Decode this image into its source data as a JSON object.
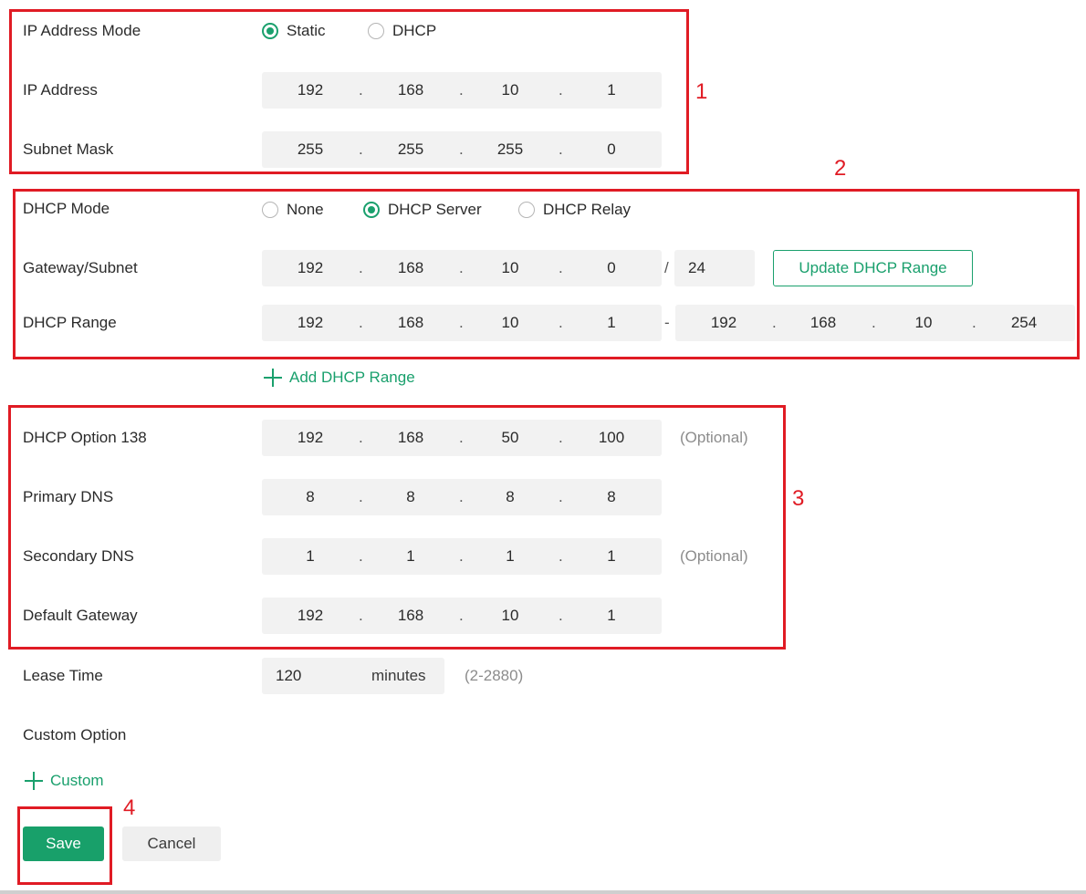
{
  "ip_address_mode": {
    "label": "IP Address Mode",
    "options": [
      {
        "label": "Static",
        "checked": true
      },
      {
        "label": "DHCP",
        "checked": false
      }
    ]
  },
  "ip_address": {
    "label": "IP Address",
    "octets": [
      "192",
      "168",
      "10",
      "1"
    ]
  },
  "subnet_mask": {
    "label": "Subnet Mask",
    "octets": [
      "255",
      "255",
      "255",
      "0"
    ]
  },
  "dhcp_mode": {
    "label": "DHCP Mode",
    "options": [
      {
        "label": "None",
        "checked": false
      },
      {
        "label": "DHCP Server",
        "checked": true
      },
      {
        "label": "DHCP Relay",
        "checked": false
      }
    ]
  },
  "gateway_subnet": {
    "label": "Gateway/Subnet",
    "octets": [
      "192",
      "168",
      "10",
      "0"
    ],
    "slash": "/",
    "prefix": "24",
    "update_button": "Update DHCP Range"
  },
  "dhcp_range": {
    "label": "DHCP Range",
    "start": [
      "192",
      "168",
      "10",
      "1"
    ],
    "separator": "-",
    "end": [
      "192",
      "168",
      "10",
      "254"
    ]
  },
  "add_dhcp_range": "Add DHCP Range",
  "dhcp_option_138": {
    "label": "DHCP Option 138",
    "octets": [
      "192",
      "168",
      "50",
      "100"
    ],
    "hint": "(Optional)"
  },
  "primary_dns": {
    "label": "Primary DNS",
    "octets": [
      "8",
      "8",
      "8",
      "8"
    ]
  },
  "secondary_dns": {
    "label": "Secondary DNS",
    "octets": [
      "1",
      "1",
      "1",
      "1"
    ],
    "hint": "(Optional)"
  },
  "default_gateway": {
    "label": "Default Gateway",
    "octets": [
      "192",
      "168",
      "10",
      "1"
    ]
  },
  "lease_time": {
    "label": "Lease Time",
    "value": "120",
    "unit": "minutes",
    "hint": "(2-2880)"
  },
  "custom_option": {
    "label": "Custom Option",
    "add_label": "Custom"
  },
  "buttons": {
    "save": "Save",
    "cancel": "Cancel"
  },
  "annotations": [
    "1",
    "2",
    "3",
    "4"
  ],
  "colors": {
    "accent": "#1aa06d",
    "annotation": "#e01b24",
    "field_bg": "#f2f2f2"
  }
}
